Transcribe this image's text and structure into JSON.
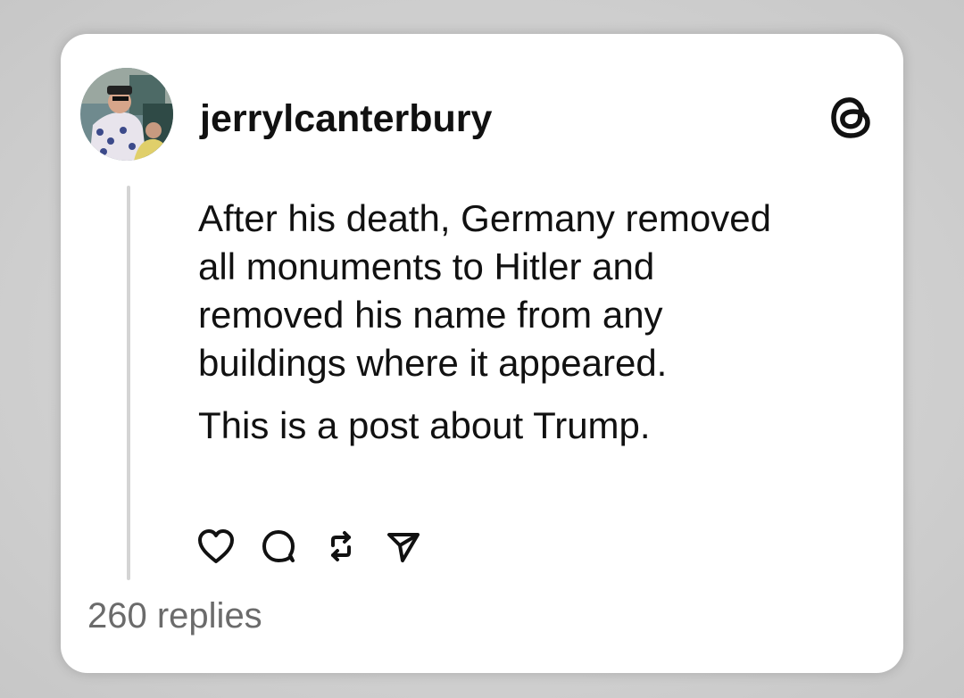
{
  "post": {
    "username": "jerrylcanterbury",
    "platform_icon": "threads-icon",
    "paragraphs": [
      "After his death, Germany removed\nall monuments to Hitler and\nremoved his name from any\nbuildings where it appeared.",
      "This is a post about Trump."
    ],
    "actions": [
      {
        "name": "like",
        "icon": "heart-icon"
      },
      {
        "name": "reply",
        "icon": "comment-icon"
      },
      {
        "name": "repost",
        "icon": "repost-icon"
      },
      {
        "name": "share",
        "icon": "send-icon"
      }
    ],
    "replies_label": "260 replies"
  },
  "colors": {
    "text": "#111111",
    "muted": "#6b6b6b",
    "thread_line": "#d4d4d4",
    "card": "#ffffff"
  }
}
